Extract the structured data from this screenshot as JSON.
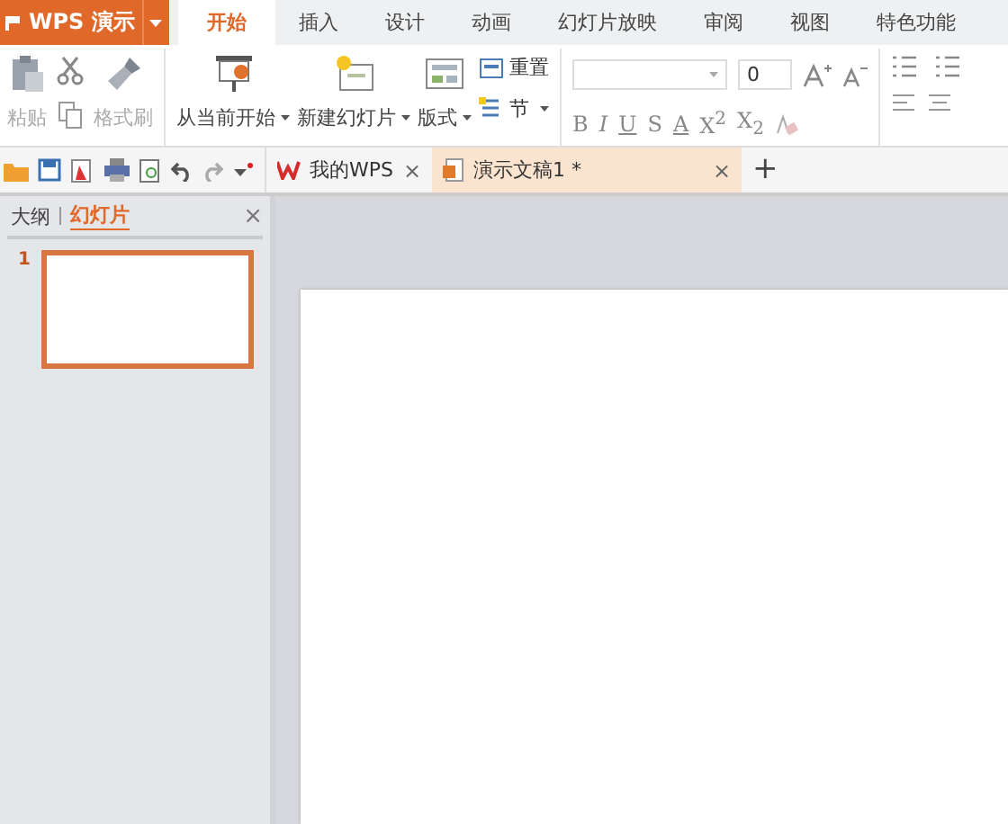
{
  "app_button": {
    "label": "WPS 演示"
  },
  "menu_tabs": [
    {
      "label": "开始",
      "selected": true
    },
    {
      "label": "插入",
      "selected": false
    },
    {
      "label": "设计",
      "selected": false
    },
    {
      "label": "动画",
      "selected": false
    },
    {
      "label": "幻灯片放映",
      "selected": false
    },
    {
      "label": "审阅",
      "selected": false
    },
    {
      "label": "视图",
      "selected": false
    },
    {
      "label": "特色功能",
      "selected": false
    }
  ],
  "ribbon": {
    "paste": {
      "label": "粘贴",
      "disabled": true
    },
    "format_painter": {
      "label": "格式刷",
      "disabled": true
    },
    "slide_buttons": [
      {
        "label": "从当前开始",
        "kind": "play"
      },
      {
        "label": "新建幻灯片",
        "kind": "new"
      },
      {
        "label": "版式",
        "kind": "layout"
      }
    ],
    "reset": "重置",
    "section": "节",
    "font_size": "0",
    "format_buttons": [
      "B",
      "I",
      "U",
      "S",
      "A",
      "X$^{2}$",
      "X$_{2}$"
    ]
  },
  "doc_tabs": [
    {
      "label": "我的WPS",
      "kind": "home",
      "selected": false,
      "close": "×"
    },
    {
      "label": "演示文稿1 *",
      "kind": "doc",
      "selected": true,
      "close": "×"
    }
  ],
  "new_tab": "+",
  "sidebar": {
    "tabs": [
      {
        "label": "大纲",
        "selected": false
      },
      {
        "label": "幻灯片",
        "selected": true
      }
    ],
    "close": "×",
    "slides": [
      {
        "number": "1",
        "selected": true
      }
    ]
  }
}
